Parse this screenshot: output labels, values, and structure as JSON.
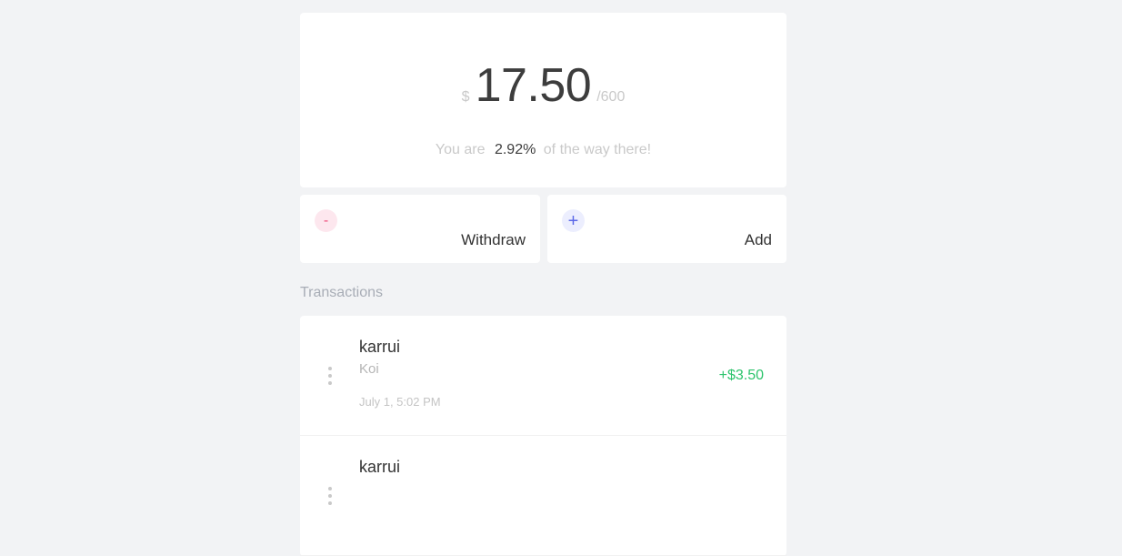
{
  "summary": {
    "currency_symbol": "$",
    "balance": "17.50",
    "goal": "/600",
    "progress_prefix": "You are",
    "progress_percent": "2.92%",
    "progress_suffix": "of the way there!"
  },
  "actions": {
    "withdraw": {
      "icon_symbol": "-",
      "label": "Withdraw",
      "icon": "minus-icon",
      "icon_color": "#ef4f7c"
    },
    "add": {
      "icon_symbol": "+",
      "label": "Add",
      "icon": "plus-icon",
      "icon_color": "#5b68e8"
    }
  },
  "transactions": {
    "title": "Transactions",
    "items": [
      {
        "user": "karrui",
        "note": "Koi",
        "date": "July 1, 5:02 PM",
        "amount": "+$3.50",
        "amount_color": "#2ec46d"
      },
      {
        "user": "karrui",
        "note": "",
        "date": "",
        "amount": ""
      }
    ]
  }
}
